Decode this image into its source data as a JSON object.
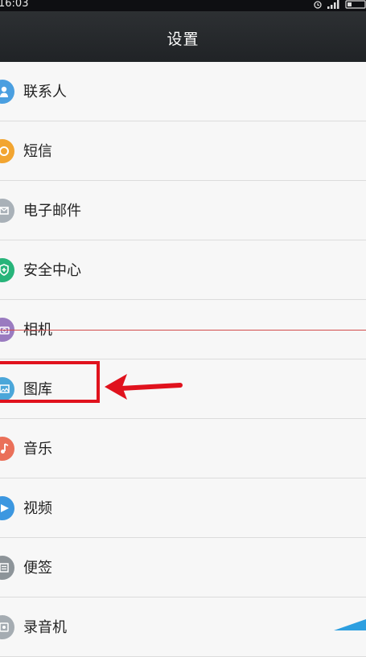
{
  "status_bar": {
    "time": "16:03"
  },
  "header": {
    "title": "设置"
  },
  "items": [
    {
      "label": "联系人",
      "icon": "contacts-icon",
      "color": "#4a9fe0"
    },
    {
      "label": "短信",
      "icon": "sms-icon",
      "color": "#f2a531"
    },
    {
      "label": "电子邮件",
      "icon": "email-icon",
      "color": "#a9b1b8"
    },
    {
      "label": "安全中心",
      "icon": "security-center-icon",
      "color": "#27b47a"
    },
    {
      "label": "相机",
      "icon": "camera-icon",
      "color": "#9a7bc0"
    },
    {
      "label": "图库",
      "icon": "gallery-icon",
      "color": "#4aa6d9"
    },
    {
      "label": "音乐",
      "icon": "music-icon",
      "color": "#ea7059"
    },
    {
      "label": "视频",
      "icon": "video-icon",
      "color": "#3c97e0"
    },
    {
      "label": "便签",
      "icon": "notes-icon",
      "color": "#8d9499"
    },
    {
      "label": "录音机",
      "icon": "recorder-icon",
      "color": "#a5acb2"
    }
  ],
  "annotation": {
    "highlight_color": "#e0121d"
  }
}
